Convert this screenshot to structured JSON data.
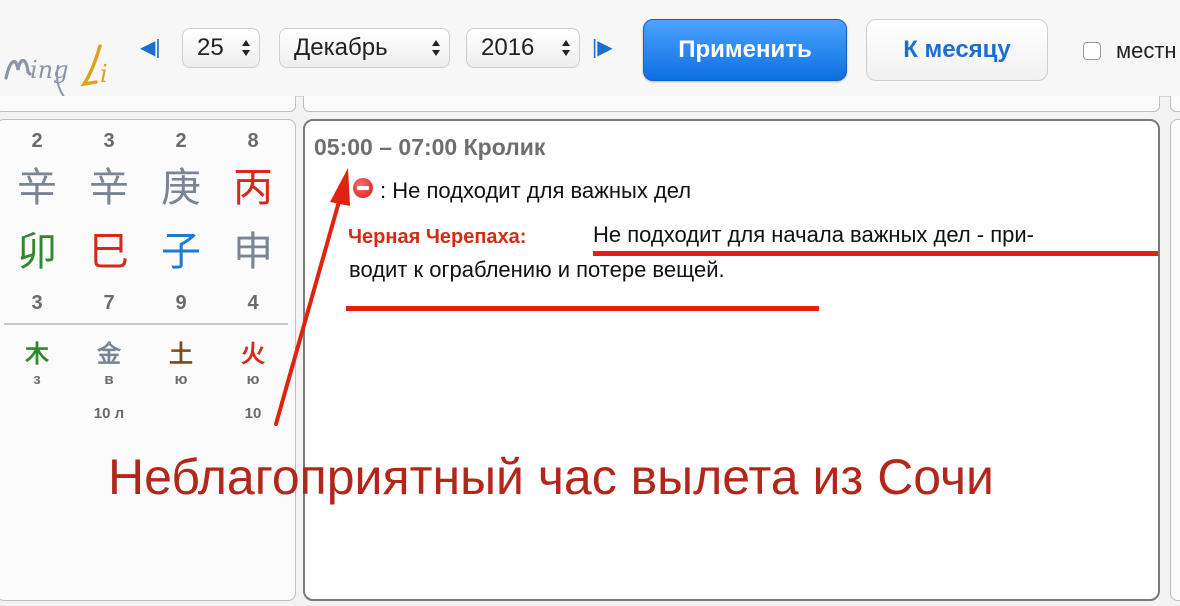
{
  "header": {
    "logo_text": "MingLi",
    "day": "25",
    "month": "Декабрь",
    "year": "2016",
    "apply_label": "Применить",
    "to_month_label": "К месяцу",
    "local_label": "местн"
  },
  "pillars": {
    "top_numbers": [
      "2",
      "3",
      "2",
      "8"
    ],
    "stems": [
      {
        "char": "辛",
        "color": "#7a8594"
      },
      {
        "char": "辛",
        "color": "#7a8594"
      },
      {
        "char": "庚",
        "color": "#7a8594"
      },
      {
        "char": "丙",
        "color": "#d8271c"
      }
    ],
    "branches": [
      {
        "char": "卯",
        "color": "#2f8a2f"
      },
      {
        "char": "巳",
        "color": "#d8271c"
      },
      {
        "char": "子",
        "color": "#1f79d6"
      },
      {
        "char": "申",
        "color": "#7a8594"
      }
    ],
    "bottom_numbers": [
      "3",
      "7",
      "9",
      "4"
    ],
    "elements": [
      {
        "char": "木",
        "color": "#2f8a2f"
      },
      {
        "char": "金",
        "color": "#7a8594"
      },
      {
        "char": "土",
        "color": "#7a4a1d"
      },
      {
        "char": "火",
        "color": "#d8271c"
      }
    ],
    "element_letters": [
      "з",
      "в",
      "ю",
      "ю"
    ],
    "extra": [
      "",
      "10 л",
      "",
      "10"
    ]
  },
  "hour": {
    "title": "05:00 – 07:00 Кролик",
    "status_text": ": Не подходит для важных дел",
    "star_label": "Черная Черепаха:",
    "star_desc_line1": "Не подходит для начала важных дел - при-",
    "star_desc_line2": "водит к ограблению и потере вещей."
  },
  "annotation": {
    "caption": "Неблагоприятный час вылета из Сочи",
    "color": "#e0220f"
  }
}
